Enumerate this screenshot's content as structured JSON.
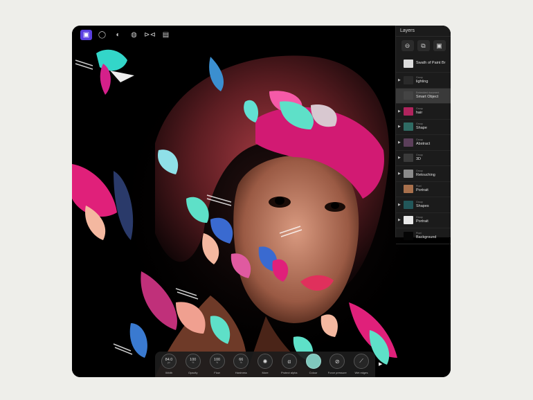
{
  "toolbar": {
    "tools": [
      {
        "name": "persona-icon",
        "glyph": "▣",
        "active": true
      },
      {
        "name": "history-icon",
        "glyph": "◯",
        "active": false
      },
      {
        "name": "palette-icon",
        "glyph": "◐",
        "active": false
      },
      {
        "name": "brush-icon",
        "glyph": "◍",
        "active": false
      },
      {
        "name": "flip-icon",
        "glyph": "⊳⊲",
        "active": false
      },
      {
        "name": "document-icon",
        "glyph": "▤",
        "active": false
      }
    ]
  },
  "layers": {
    "title": "Layers",
    "actions": [
      "⊖",
      "⧉",
      "▣"
    ],
    "items": [
      {
        "type": "",
        "name": "Swath of Paint Br",
        "thumb": "#dcdcdc",
        "arrow": false,
        "selected": false
      },
      {
        "type": "Group",
        "name": "lighting",
        "thumb": "#2a2a2a",
        "arrow": true,
        "selected": false
      },
      {
        "type": "Embedded document",
        "name": "Smart Object",
        "thumb": "#444444",
        "arrow": false,
        "selected": true
      },
      {
        "type": "Group",
        "name": "hair",
        "thumb": "#b0245d",
        "arrow": true,
        "selected": false
      },
      {
        "type": "Group",
        "name": "Shape",
        "thumb": "#2f6b63",
        "arrow": true,
        "selected": false
      },
      {
        "type": "Group",
        "name": "Abstract",
        "thumb": "#5b3f5a",
        "arrow": true,
        "selected": false
      },
      {
        "type": "Group",
        "name": "3D",
        "thumb": "#3a3a3a",
        "arrow": true,
        "selected": false
      },
      {
        "type": "Group",
        "name": "Retouching",
        "thumb": "#8a8a8a",
        "arrow": true,
        "selected": false
      },
      {
        "type": "Pixel",
        "name": "Portrait",
        "thumb": "#a8704c",
        "arrow": false,
        "selected": false
      },
      {
        "type": "Group",
        "name": "Shapes",
        "thumb": "#22575a",
        "arrow": true,
        "selected": false
      },
      {
        "type": "Group",
        "name": "Portrait",
        "thumb": "#e8e8e8",
        "arrow": true,
        "selected": false
      },
      {
        "type": "Pixel",
        "name": "Background",
        "thumb": "#050505",
        "arrow": false,
        "selected": false
      }
    ]
  },
  "brush": {
    "controls": [
      {
        "label": "Width",
        "value": "84.0",
        "unit": "px"
      },
      {
        "label": "Opacity",
        "value": "100",
        "unit": "%"
      },
      {
        "label": "Flow",
        "value": "100",
        "unit": "%"
      },
      {
        "label": "Hardness",
        "value": "66",
        "unit": "%"
      },
      {
        "label": "More",
        "value": "",
        "unit": "",
        "icon": "✺"
      },
      {
        "label": "Protect alpha",
        "value": "",
        "unit": "",
        "icon": "α"
      },
      {
        "label": "Colour",
        "value": "",
        "unit": "",
        "swatch": true
      },
      {
        "label": "Force pressure",
        "value": "",
        "unit": "",
        "icon": "⊘"
      },
      {
        "label": "Wet edges",
        "value": "",
        "unit": "",
        "icon": "⟋"
      }
    ],
    "colour": "#7fc8bd",
    "play_glyph": "▶"
  }
}
